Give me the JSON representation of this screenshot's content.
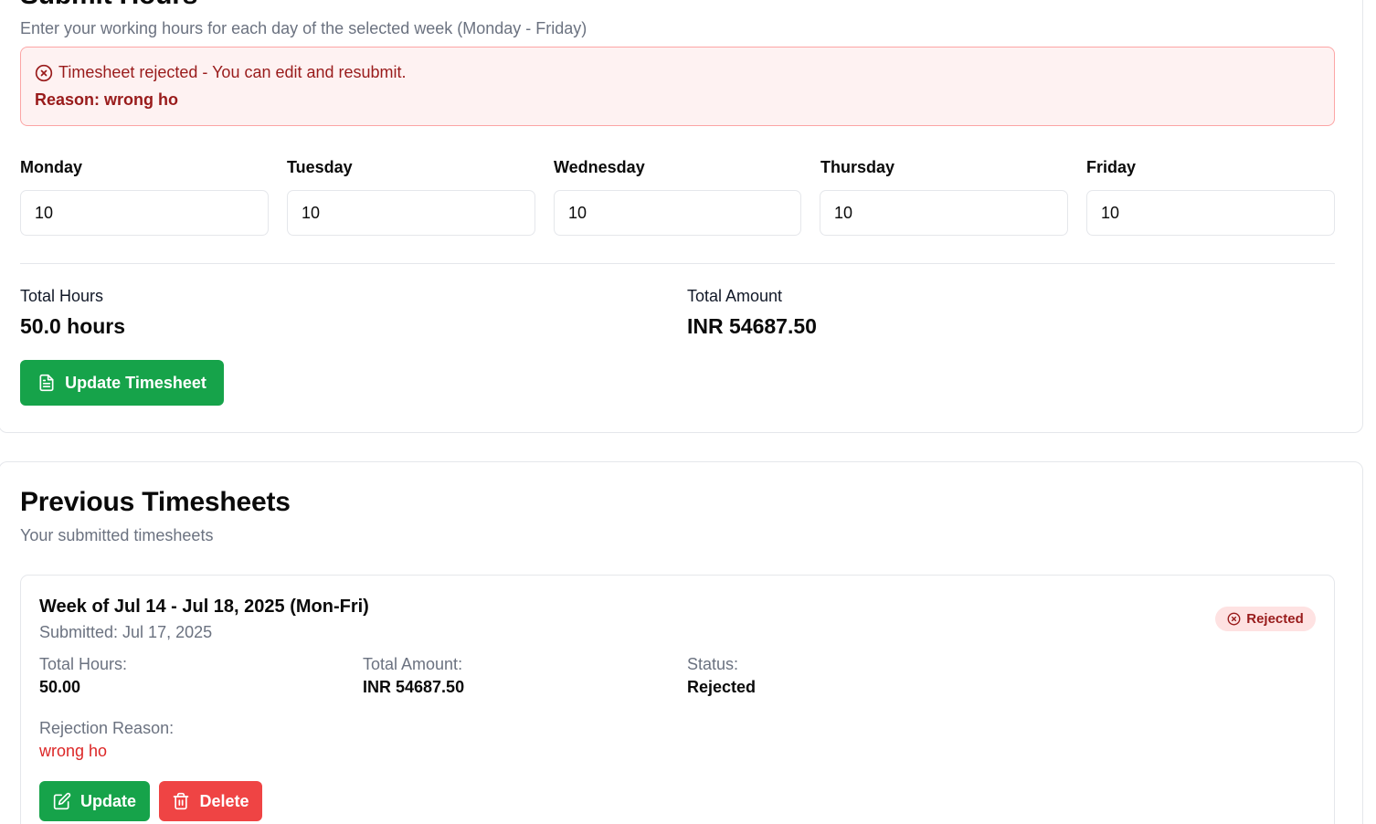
{
  "submit": {
    "title": "Submit Hours",
    "subtitle": "Enter your working hours for each day of the selected week (Monday - Friday)",
    "alert": {
      "message": "Timesheet rejected - You can edit and resubmit.",
      "reason": "Reason: wrong ho"
    },
    "days": [
      {
        "label": "Monday",
        "value": "10"
      },
      {
        "label": "Tuesday",
        "value": "10"
      },
      {
        "label": "Wednesday",
        "value": "10"
      },
      {
        "label": "Thursday",
        "value": "10"
      },
      {
        "label": "Friday",
        "value": "10"
      }
    ],
    "total_hours_label": "Total Hours",
    "total_hours_value": "50.0 hours",
    "total_amount_label": "Total Amount",
    "total_amount_value": "INR 54687.50",
    "update_button": "Update Timesheet"
  },
  "previous": {
    "title": "Previous Timesheets",
    "subtitle": "Your submitted timesheets",
    "sheets": [
      {
        "week": "Week of Jul 14 - Jul 18, 2025 (Mon-Fri)",
        "submitted": "Submitted: Jul 17, 2025",
        "badge": "Rejected",
        "total_hours_label": "Total Hours:",
        "total_hours": "50.00",
        "total_amount_label": "Total Amount:",
        "total_amount": "INR 54687.50",
        "status_label": "Status:",
        "status": "Rejected",
        "rejection_label": "Rejection Reason:",
        "rejection_reason": "wrong ho",
        "update_button": "Update",
        "delete_button": "Delete"
      }
    ]
  },
  "colors": {
    "primary_green": "#16a34a",
    "danger_red": "#ef4444",
    "alert_bg": "#fef2f2",
    "alert_text": "#991b1b"
  }
}
